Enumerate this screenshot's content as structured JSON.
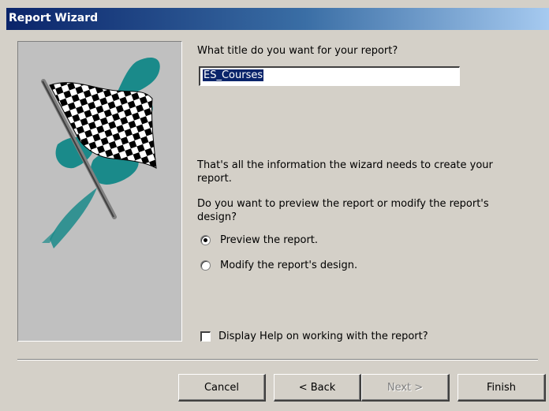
{
  "window": {
    "title": "Report Wizard"
  },
  "question_title": "What title do you want for your report?",
  "report_title_value": "ES_Courses",
  "info_text": "That's all the information the wizard needs to create your report.",
  "question_preview": "Do you want to preview the report or modify the report's design?",
  "options": [
    {
      "label": "Preview the report.",
      "selected": true
    },
    {
      "label": "Modify the report's design.",
      "selected": false
    }
  ],
  "help_checkbox": {
    "label": "Display Help on working with the report?",
    "checked": false
  },
  "buttons": {
    "cancel": "Cancel",
    "back": "< Back",
    "next": "Next >",
    "finish": "Finish"
  },
  "icons": {
    "wizard_image": "checkered-flag-icon"
  },
  "colors": {
    "titlebar_start": "#0a246a",
    "titlebar_end": "#a6caf0",
    "dialog_bg": "#d4d0c8",
    "accent_teal": "#1a8a8a"
  }
}
